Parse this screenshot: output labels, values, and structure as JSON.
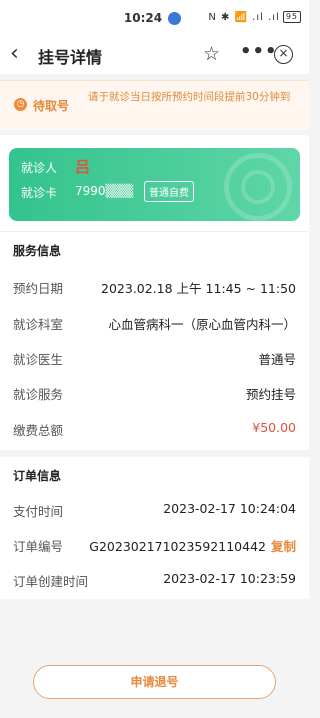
{
  "status_bar": {
    "time": "10:24",
    "indicators": "N ✱ 📶 .ıl .ıl",
    "battery": "95"
  },
  "nav": {
    "title": "挂号详情",
    "back_icon": "back-arrow",
    "star_icon": "☆",
    "more_icon": "•••",
    "close_icon": "×"
  },
  "notice": {
    "status": "待取号",
    "message": "请于就诊当日按所预约时间段提前30分钟到"
  },
  "patient_card": {
    "name_label": "就诊人",
    "name": "吕",
    "card_label": "就诊卡",
    "card_number": "7990▒▒▒",
    "card_type": "普通自费"
  },
  "service_info": {
    "title": "服务信息",
    "rows": [
      {
        "label": "预约日期",
        "value": "2023.02.18 上午 11:45 ~ 11:50"
      },
      {
        "label": "就诊科室",
        "value": "心血管病科一（原心血管内科一）"
      },
      {
        "label": "就诊医生",
        "value": "普通号"
      },
      {
        "label": "就诊服务",
        "value": "预约挂号"
      },
      {
        "label": "缴费总额",
        "value": "¥50.00"
      }
    ]
  },
  "order_info": {
    "title": "订单信息",
    "rows": [
      {
        "label": "支付时间",
        "value": "2023-02-17 10:24:04"
      },
      {
        "label": "订单编号",
        "value": "G202302171023592110442"
      },
      {
        "label": "订单创建时间",
        "value": "2023-02-17 10:23:59"
      }
    ],
    "copy_label": "复制"
  },
  "refund_button": "申请退号",
  "colors": {
    "accent": "#e68a3a",
    "card_green": "#34c38d",
    "fee_red": "#e0523c"
  }
}
